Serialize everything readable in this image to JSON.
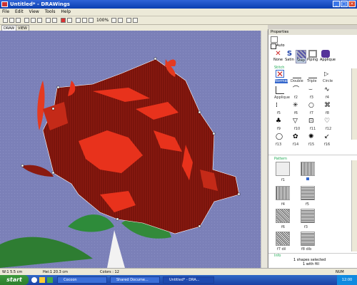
{
  "window": {
    "title": "Untitled* - DRAWings"
  },
  "menu": [
    "File",
    "Edit",
    "View",
    "Tools",
    "Help"
  ],
  "toolbar": {
    "zoom": "100%"
  },
  "doc_tabs": [
    "DRAW",
    "VIEW"
  ],
  "properties": {
    "title": "Properties",
    "auto_label": "Auto",
    "tabs": [
      {
        "label": "None",
        "icon": "none-icon",
        "color": "#cc2222"
      },
      {
        "label": "Satin",
        "icon": "satin-icon",
        "color": "#2244aa"
      },
      {
        "label": "Step",
        "icon": "step-icon",
        "color": "#5555aa"
      },
      {
        "label": "Piping",
        "icon": "piping-icon",
        "color": "#888888"
      },
      {
        "label": "Applique",
        "icon": "applique-icon",
        "color": "#553399"
      }
    ],
    "stitch_section": "Stitch",
    "stitch_row1": [
      "Normal",
      "Double",
      "Triple",
      "Circle"
    ],
    "stitch_row2": [
      "Applique",
      "f2",
      "f3",
      "f4"
    ],
    "stitch_row3": [
      "f5",
      "f6",
      "f7",
      "f8"
    ],
    "stitch_row4": [
      "f9",
      "f10",
      "f11",
      "f12"
    ],
    "stitch_row5": [
      "f13",
      "f14",
      "f15",
      "f16"
    ],
    "pattern_section": "Pattern",
    "pattern_labels": [
      "f1",
      "f2",
      "f3",
      "f4",
      "f5",
      "f6",
      "f7 dil",
      "f8 dib"
    ],
    "info_section": "Info",
    "info_line1": "1 shapes selected",
    "info_line2": "1 with fill"
  },
  "status": {
    "width": "W:1    5.5 cm",
    "height": "Hei:1    20.3 cm",
    "colors": "Colors : 12",
    "mode": "NUM"
  },
  "taskbar": {
    "start": "start",
    "items": [
      "Cocoon",
      "Shared Docume...",
      "Untitled* - DRA..."
    ],
    "clock": "12:00"
  }
}
